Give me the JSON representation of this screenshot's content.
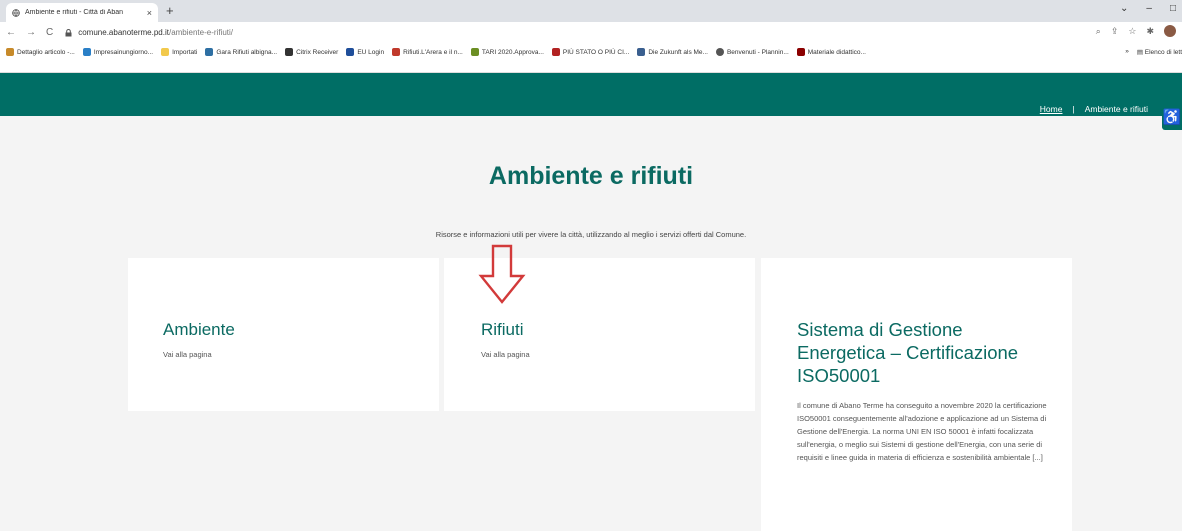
{
  "browser": {
    "tab_title": "Ambiente e rifiuti - Città di Aban",
    "tab_close": "×",
    "new_tab": "+",
    "win_controls": [
      "⌄",
      "–",
      "□"
    ],
    "url_host": "comune.abanoterme.pd.it",
    "url_path": "/ambiente-e-rifiuti/",
    "bookmarks": [
      {
        "label": "Dettaglio articolo -...",
        "color": "#c78a2a"
      },
      {
        "label": "Impresainungiorno...",
        "color": "#2a7fc7"
      },
      {
        "label": "Importati",
        "color": "#f2c94c"
      },
      {
        "label": "Gara Rifiuti albigna...",
        "color": "#2e6fa3"
      },
      {
        "label": "Citrix Receiver",
        "color": "#333333"
      },
      {
        "label": "EU Login",
        "color": "#1f4e9a"
      },
      {
        "label": "Rifiuti.L'Arera e il n...",
        "color": "#c0392b"
      },
      {
        "label": "TARI 2020.Approva...",
        "color": "#6b8e23"
      },
      {
        "label": "PIÙ STATO O PIÙ CI...",
        "color": "#b22222"
      },
      {
        "label": "Die Zukunft als Me...",
        "color": "#3a5f8f"
      },
      {
        "label": "Benvenuti - Plannin...",
        "color": "#555555"
      },
      {
        "label": "Materiale didattico...",
        "color": "#8b0000"
      }
    ],
    "bookmarks_more": "»",
    "reading_list": "Elenco di lett"
  },
  "header": {
    "breadcrumb_home": "Home",
    "breadcrumb_sep": "|",
    "breadcrumb_current": "Ambiente e rifiuti",
    "accessibility_glyph": "♿"
  },
  "main": {
    "title": "Ambiente e rifiuti",
    "subtitle": "Risorse e informazioni utili per vivere la città, utilizzando al meglio i servizi offerti dal Comune.",
    "cards": [
      {
        "title": "Ambiente",
        "link": "Vai alla pagina"
      },
      {
        "title": "Rifiuti",
        "link": "Vai alla pagina"
      },
      {
        "title": "Sistema di Gestione Energetica – Certificazione ISO50001",
        "description": "Il comune di Abano Terme ha conseguito a novembre 2020 la certificazione ISO50001 conseguentemente all'adozione e applicazione ad un Sistema di Gestione dell'Energia. La norma UNI EN ISO 50001 è infatti focalizzata sull'energia, o meglio sui Sistemi di gestione dell'Energia, con una serie di requisiti e linee guida in materia di efficienza e sostenibilità ambientale [...]"
      }
    ]
  },
  "colors": {
    "brand": "#006e65",
    "title": "#0b6a62",
    "arrow": "#d23a3a"
  }
}
